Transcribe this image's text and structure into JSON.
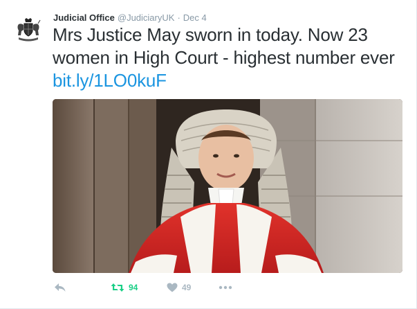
{
  "tweet": {
    "author_name": "Judicial Office",
    "handle": "@JudiciaryUK",
    "separator": "·",
    "date": "Dec 4",
    "text": "Mrs Justice May sworn in today. Now 23 women in High Court - highest number ever",
    "link_text": "bit.ly/1LO0kuF",
    "photo_icon": "photo-of-judge-in-wig-and-red-robe"
  },
  "actions": {
    "reply_icon": "reply-icon",
    "retweet_icon": "retweet-icon",
    "retweet_count": "94",
    "like_icon": "heart-icon",
    "like_count": "49",
    "more_icon": "more-icon"
  },
  "colors": {
    "link": "#1b95e0",
    "retweet_active": "#19cf86",
    "muted": "#aab8c2",
    "text": "#292f33"
  }
}
